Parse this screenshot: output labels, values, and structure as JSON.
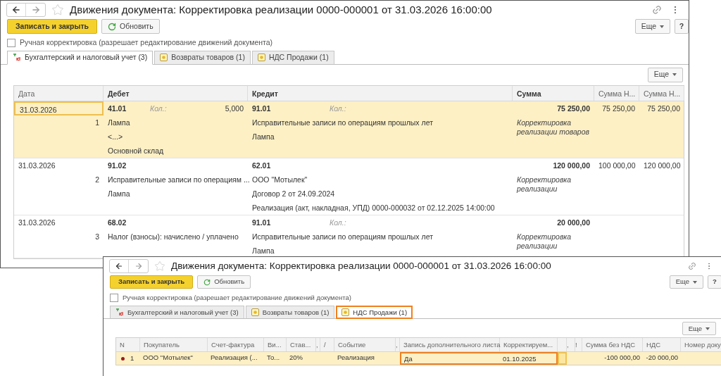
{
  "windows": [
    {
      "kind": "postings",
      "title": "Движения документа: Корректировка реализации 0000-000001 от 31.03.2026 16:00:00",
      "save_button": "Записать и закрыть",
      "refresh_button": "Обновить",
      "more_button": "Еще",
      "help_button": "?",
      "manual_edit": {
        "label": "Ручная корректировка (разрешает редактирование движений документа)",
        "checked": false
      },
      "tabs": [
        {
          "kind": "ledger",
          "label": "Бухгалтерский и налоговый учет (3)",
          "selected": true,
          "highlighted": false
        },
        {
          "kind": "register",
          "label": "Возвраты товаров (1)",
          "selected": false,
          "highlighted": false
        },
        {
          "kind": "register",
          "label": "НДС Продажи (1)",
          "selected": false,
          "highlighted": false
        }
      ],
      "table_more_button": "Еще",
      "columns": [
        {
          "label": "Дата",
          "emphasis": false
        },
        {
          "label": "Дебет",
          "emphasis": true
        },
        {
          "label": "Кредит",
          "emphasis": true
        },
        {
          "label": "Сумма",
          "emphasis": true
        },
        {
          "label": "Сумма Н...",
          "emphasis": false
        },
        {
          "label": "Сумма Н...",
          "emphasis": false
        }
      ],
      "rows": [
        {
          "selected": true,
          "date_focused": true,
          "date": "31.03.2026",
          "number": "1",
          "debit": {
            "account": "41.01",
            "qty_label": "Кол.:",
            "qty": "5,000",
            "lines": [
              "Лампа",
              "<...>",
              "Основной склад"
            ]
          },
          "credit": {
            "account": "91.01",
            "qty_label": "Кол.:",
            "lines": [
              "Исправительные записи по операциям прошлых лет",
              "Лампа"
            ]
          },
          "sum": "75 250,00",
          "content": "Корректировка реализации товаров",
          "column_5": "75 250,00",
          "column_6": "75 250,00"
        },
        {
          "selected": false,
          "date_focused": false,
          "date": "31.03.2026",
          "number": "2",
          "debit": {
            "account": "91.02",
            "lines": [
              "Исправительные записи по операциям ...",
              "Лампа"
            ]
          },
          "credit": {
            "account": "62.01",
            "lines": [
              "ООО \"Мотылек\"",
              "Договор 2 от 24.09.2024",
              "Реализация (акт, накладная, УПД) 0000-000032 от 02.12.2025 14:00:00"
            ]
          },
          "sum": "120 000,00",
          "content": "Корректировка реализации",
          "column_5": "100 000,00",
          "column_6": "120 000,00"
        },
        {
          "selected": false,
          "date_focused": false,
          "date": "31.03.2026",
          "number": "3",
          "debit": {
            "account": "68.02",
            "lines": [
              "Налог (взносы): начислено / уплачено"
            ]
          },
          "credit": {
            "account": "91.01",
            "qty_label": "Кол.:",
            "lines": [
              "Исправительные записи по операциям прошлых лет",
              "Лампа"
            ]
          },
          "sum": "20 000,00",
          "content": "Корректировка реализации"
        }
      ]
    },
    {
      "kind": "vat_sales",
      "title": "Движения документа: Корректировка реализации 0000-000001 от 31.03.2026 16:00:00",
      "save_button": "Записать и закрыть",
      "refresh_button": "Обновить",
      "more_button": "Еще",
      "help_button": "?",
      "manual_edit": {
        "label": "Ручная корректировка (разрешает редактирование движений документа)",
        "checked": false
      },
      "tabs": [
        {
          "kind": "ledger",
          "label": "Бухгалтерский и налоговый учет (3)",
          "selected": false,
          "highlighted": false
        },
        {
          "kind": "register",
          "label": "Возвраты товаров (1)",
          "selected": false,
          "highlighted": false
        },
        {
          "kind": "register",
          "label": "НДС Продажи (1)",
          "selected": true,
          "highlighted": true
        }
      ],
      "table_more_button": "Еще",
      "columns": [
        {
          "label": "N",
          "kind": "text"
        },
        {
          "label": "Покупатель",
          "kind": "text"
        },
        {
          "label": "Счет-фактура",
          "kind": "text"
        },
        {
          "label": "Ви...",
          "kind": "text"
        },
        {
          "label": "Став...",
          "kind": "text"
        },
        {
          "label": ",",
          "kind": "text"
        },
        {
          "label": "/",
          "kind": "text"
        },
        {
          "label": "Событие",
          "kind": "text"
        },
        {
          "label": ",",
          "kind": "text"
        },
        {
          "label": "Запись дополнительного листа",
          "kind": "text"
        },
        {
          "label": "Корректируем...",
          "kind": "text"
        },
        {
          "kind": "text"
        },
        {
          "label": ",",
          "kind": "text"
        },
        {
          "label": "!",
          "kind": "text"
        },
        {
          "label": "Сумма без НДС",
          "kind": "number"
        },
        {
          "label": "НДС",
          "kind": "number"
        },
        {
          "label": "Номер доку",
          "kind": "text"
        }
      ],
      "rows": [
        {
          "selected": true,
          "marked": true,
          "cells": [
            {
              "kind": "plain",
              "text": "1"
            },
            {
              "kind": "plain",
              "text": "ООО \"Мотылек\""
            },
            {
              "kind": "plain",
              "text": "Реализация (..."
            },
            {
              "kind": "plain",
              "text": "То..."
            },
            {
              "kind": "plain",
              "text": "20%"
            },
            {
              "kind": "plain"
            },
            {
              "kind": "plain"
            },
            {
              "kind": "plain",
              "text": "Реализация"
            },
            {
              "kind": "plain"
            },
            {
              "kind": "outlined",
              "text": "Да"
            },
            {
              "kind": "outlined",
              "text": "01.10.2025"
            },
            {
              "kind": "current"
            },
            {
              "kind": "plain"
            },
            {
              "kind": "plain"
            },
            {
              "kind": "plain",
              "text": "-100 000,00"
            },
            {
              "kind": "plain",
              "text": "-20 000,00"
            },
            {
              "kind": "plain"
            }
          ]
        }
      ]
    }
  ]
}
